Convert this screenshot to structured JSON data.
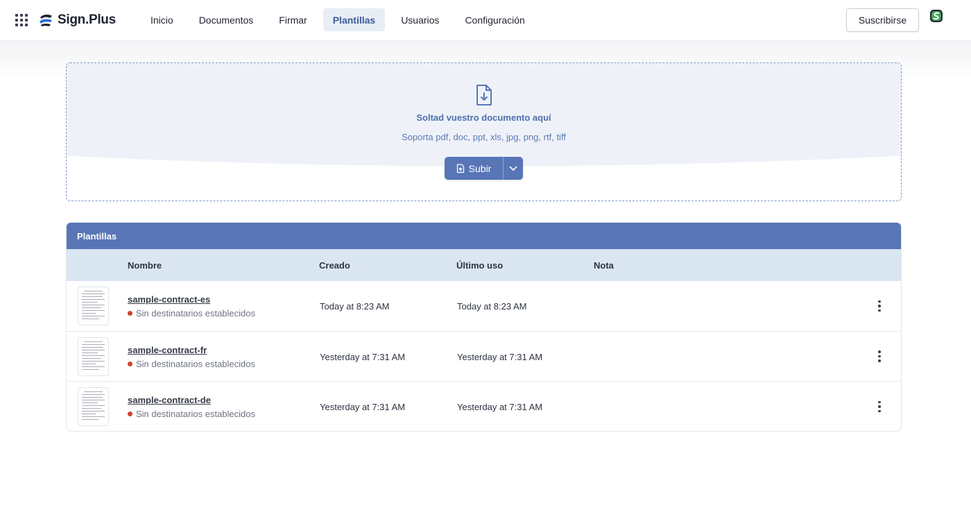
{
  "header": {
    "brand": "Sign.Plus",
    "nav": [
      {
        "label": "Inicio",
        "active": false
      },
      {
        "label": "Documentos",
        "active": false
      },
      {
        "label": "Firmar",
        "active": false
      },
      {
        "label": "Plantillas",
        "active": true
      },
      {
        "label": "Usuarios",
        "active": false
      },
      {
        "label": "Configuración",
        "active": false
      }
    ],
    "subscribe_label": "Suscribirse",
    "accent_color": "#5876b6"
  },
  "dropzone": {
    "title": "Soltad vuestro documento aquí",
    "subtitle": "Soporta pdf, doc, ppt, xls, jpg, png, rtf, tiff",
    "upload_label": "Subir",
    "icon": "file-download-icon"
  },
  "templates": {
    "panel_title": "Plantillas",
    "columns": {
      "name": "Nombre",
      "created": "Creado",
      "last_used": "Último uso",
      "note": "Nota"
    },
    "rows": [
      {
        "name": "sample-contract-es",
        "status": "Sin destinatarios establecidos",
        "created": "Today at 8:23 AM",
        "last_used": "Today at 8:23 AM",
        "note": ""
      },
      {
        "name": "sample-contract-fr",
        "status": "Sin destinatarios establecidos",
        "created": "Yesterday at 7:31 AM",
        "last_used": "Yesterday at 7:31 AM",
        "note": ""
      },
      {
        "name": "sample-contract-de",
        "status": "Sin destinatarios establecidos",
        "created": "Yesterday at 7:31 AM",
        "last_used": "Yesterday at 7:31 AM",
        "note": ""
      }
    ],
    "status_color": "#d0442a",
    "header_color": "#dae6f1"
  }
}
